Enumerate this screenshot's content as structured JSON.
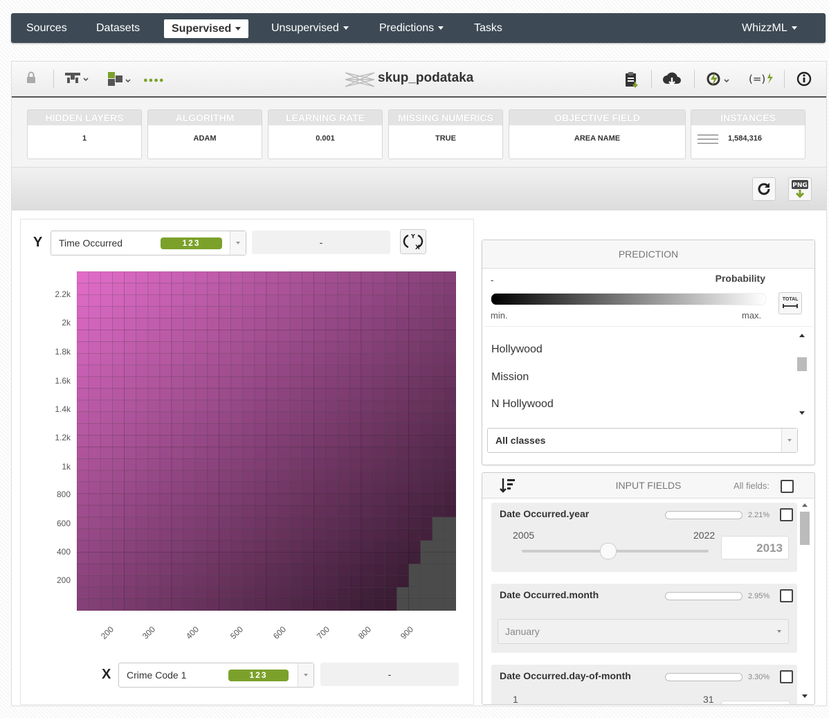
{
  "nav": {
    "items": [
      "Sources",
      "Datasets",
      "Supervised",
      "Unsupervised",
      "Predictions",
      "Tasks"
    ],
    "right": "WhizzML"
  },
  "toolbar": {
    "title": "skup_podataka",
    "dots": "●●●●"
  },
  "summary": [
    {
      "label": "HIDDEN LAYERS",
      "value": "1"
    },
    {
      "label": "ALGORITHM",
      "value": "ADAM"
    },
    {
      "label": "LEARNING RATE",
      "value": "0.001"
    },
    {
      "label": "MISSING NUMERICS",
      "value": "TRUE"
    },
    {
      "label": "OBJECTIVE FIELD",
      "value": "AREA NAME"
    },
    {
      "label": "INSTANCES",
      "value": "1,584,316"
    }
  ],
  "actions": {
    "png": "PNG"
  },
  "chart": {
    "y_axis_letter": "Y",
    "x_axis_letter": "X",
    "y_field": "Time Occurred",
    "x_field": "Crime Code 1",
    "type_pill": "123",
    "secondary_placeholder": "-",
    "y_ticks": [
      "2.2k",
      "2k",
      "1.8k",
      "1.6k",
      "1.4k",
      "1.2k",
      "1k",
      "800",
      "600",
      "400",
      "200"
    ],
    "x_ticks": [
      "200",
      "300",
      "400",
      "500",
      "600",
      "700",
      "800",
      "900"
    ]
  },
  "prediction": {
    "header": "PREDICTION",
    "value": "-",
    "legend_label": "Probability",
    "min": "min.",
    "max": "max.",
    "total_btn": "TOTAL",
    "classes": [
      "Hollywood",
      "Mission",
      "N Hollywood"
    ],
    "class_select": "All classes"
  },
  "inputs": {
    "header": "INPUT FIELDS",
    "all_fields": "All fields:",
    "fields": [
      {
        "name": "Date Occurred.year",
        "pct": "2.21%",
        "min": "2005",
        "max": "2022",
        "value": "2013"
      },
      {
        "name": "Date Occurred.month",
        "pct": "2.95%",
        "select": "January"
      },
      {
        "name": "Date Occurred.day-of-month",
        "pct": "3.30%",
        "min": "1",
        "max": "31"
      }
    ]
  }
}
